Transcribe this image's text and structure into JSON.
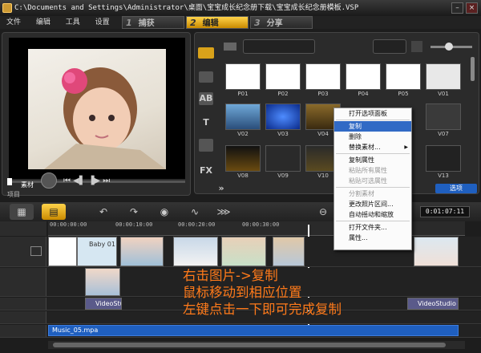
{
  "window": {
    "title": "C:\\Documents and Settings\\Administrator\\桌面\\宝宝成长纪念册下载\\宝宝成长纪念册模板.VSP",
    "close_glyph": "×",
    "min_glyph": "–"
  },
  "menu": {
    "items": [
      "文件",
      "编辑",
      "工具",
      "设置"
    ]
  },
  "steps": [
    {
      "num": "1",
      "label": "捕获"
    },
    {
      "num": "2",
      "label": "编辑"
    },
    {
      "num": "3",
      "label": "分享"
    }
  ],
  "player": {
    "mode_project": "项目",
    "mode_clip": "素材"
  },
  "library": {
    "side_buttons": [
      "AB",
      "T",
      "FX",
      "»"
    ],
    "options_label": "选项",
    "thumbs_row1": [
      "P01",
      "P02",
      "P03",
      "P04",
      "P05",
      "V01"
    ],
    "thumbs_row2": [
      "V02",
      "V03",
      "V04",
      "",
      "",
      "V07"
    ],
    "thumbs_row3": [
      "V08",
      "V09",
      "V10",
      "",
      "",
      "V13"
    ]
  },
  "context_menu": {
    "items": [
      {
        "label": "打开选项面板",
        "disabled": false
      },
      {
        "label": "复制",
        "disabled": false,
        "selected": true
      },
      {
        "label": "删除",
        "disabled": false
      },
      {
        "label": "替换素材...",
        "disabled": false,
        "arrow": "▶"
      },
      {
        "label": "复制属性",
        "disabled": false
      },
      {
        "label": "粘贴所有属性",
        "disabled": true
      },
      {
        "label": "粘贴可选属性",
        "disabled": true
      },
      {
        "label": "分割素材",
        "disabled": true
      },
      {
        "label": "更改照片区间...",
        "disabled": false
      },
      {
        "label": "自动摇动和缩放",
        "disabled": false
      },
      {
        "label": "打开文件夹...",
        "disabled": false
      },
      {
        "label": "属性...",
        "disabled": false
      }
    ]
  },
  "timeline": {
    "timecode": "0:01:07:11",
    "ruler_ticks": [
      "00:00:00:00",
      "00:00:10:00",
      "00:00:20:00",
      "00:00:30:00"
    ],
    "tracks": {
      "video_clip_label": "Baby 01",
      "overlay_clip_1": "VideoStu",
      "overlay_clip_2": "VideoStudio",
      "music": "Music_05.mpa"
    }
  },
  "annotation": {
    "line1": "右击图片->复制",
    "line2": "鼠标移动到相应位置",
    "line3": "左键点击一下即可完成复制"
  }
}
